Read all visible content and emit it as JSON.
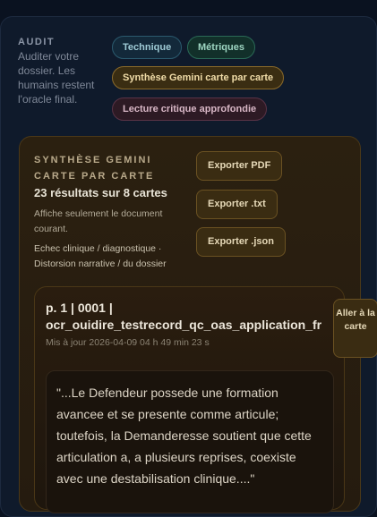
{
  "audit": {
    "label": "AUDIT",
    "description": "Auditer votre dossier. Les humains restent l'oracle final."
  },
  "tabs": {
    "technique": "Technique",
    "metriques": "Métriques",
    "synthese": "Synthèse Gemini carte par carte",
    "lecture": "Lecture critique approfondie"
  },
  "synthesis": {
    "title": "SYNTHÈSE GEMINI CARTE PAR CARTE",
    "result_count": "23 résultats sur 8 cartes",
    "note": "Affiche seulement le document courant.",
    "filter": "Echec clinique / diagnostique · Distorsion narrative / du dossier",
    "export_pdf": "Exporter PDF",
    "export_txt": "Exporter .txt",
    "export_json": "Exporter .json"
  },
  "result": {
    "title": "p. 1 | 0001 | ocr_ouidire_testrecord_qc_oas_application_fr",
    "updated": "Mis à jour 2026-04-09 04 h 49 min 23 s",
    "goto_label": "Aller à la carte",
    "quote": "\"...Le Defendeur possede une formation avancee et se presente comme articule; toutefois, la Demanderesse soutient que cette articulation a, a plusieurs reprises, coexiste avec une destabilisation clinique....\""
  }
}
